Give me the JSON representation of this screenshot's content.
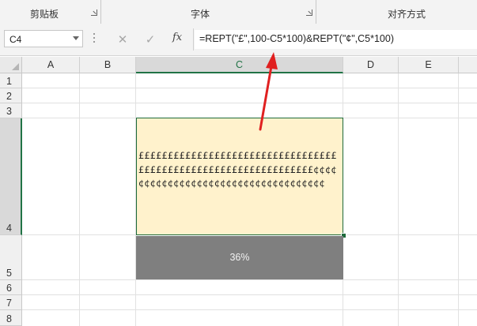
{
  "ribbon": {
    "groups": [
      {
        "label": "剪贴板",
        "launcher": true
      },
      {
        "label": "字体",
        "launcher": true
      },
      {
        "label": "对齐方式",
        "launcher": false
      }
    ]
  },
  "formula_bar": {
    "name_box": "C4",
    "cancel_icon": "✕",
    "enter_icon": "✓",
    "fx_label": "fx",
    "formula": "=REPT(\"£\",100-C5*100)&REPT(\"¢\",C5*100)"
  },
  "columns": [
    "A",
    "B",
    "C",
    "D",
    "E"
  ],
  "rows": [
    "1",
    "2",
    "3",
    "4",
    "5",
    "6",
    "7",
    "8"
  ],
  "selected": {
    "column": "C",
    "row": "4"
  },
  "cells": {
    "C4": {
      "text": "££££££££££££££££££££££££££££££££££££££££££££££££££££££££££££££££¢¢¢¢¢¢¢¢¢¢¢¢¢¢¢¢¢¢¢¢¢¢¢¢¢¢¢¢¢¢¢¢¢¢¢¢",
      "fill_color": "#fff2cc"
    },
    "C5": {
      "text": "36%",
      "fill_color": "#7f7f7f"
    }
  },
  "annotation": {
    "type": "red-arrow",
    "color": "#e02020",
    "points_to": "formula"
  }
}
